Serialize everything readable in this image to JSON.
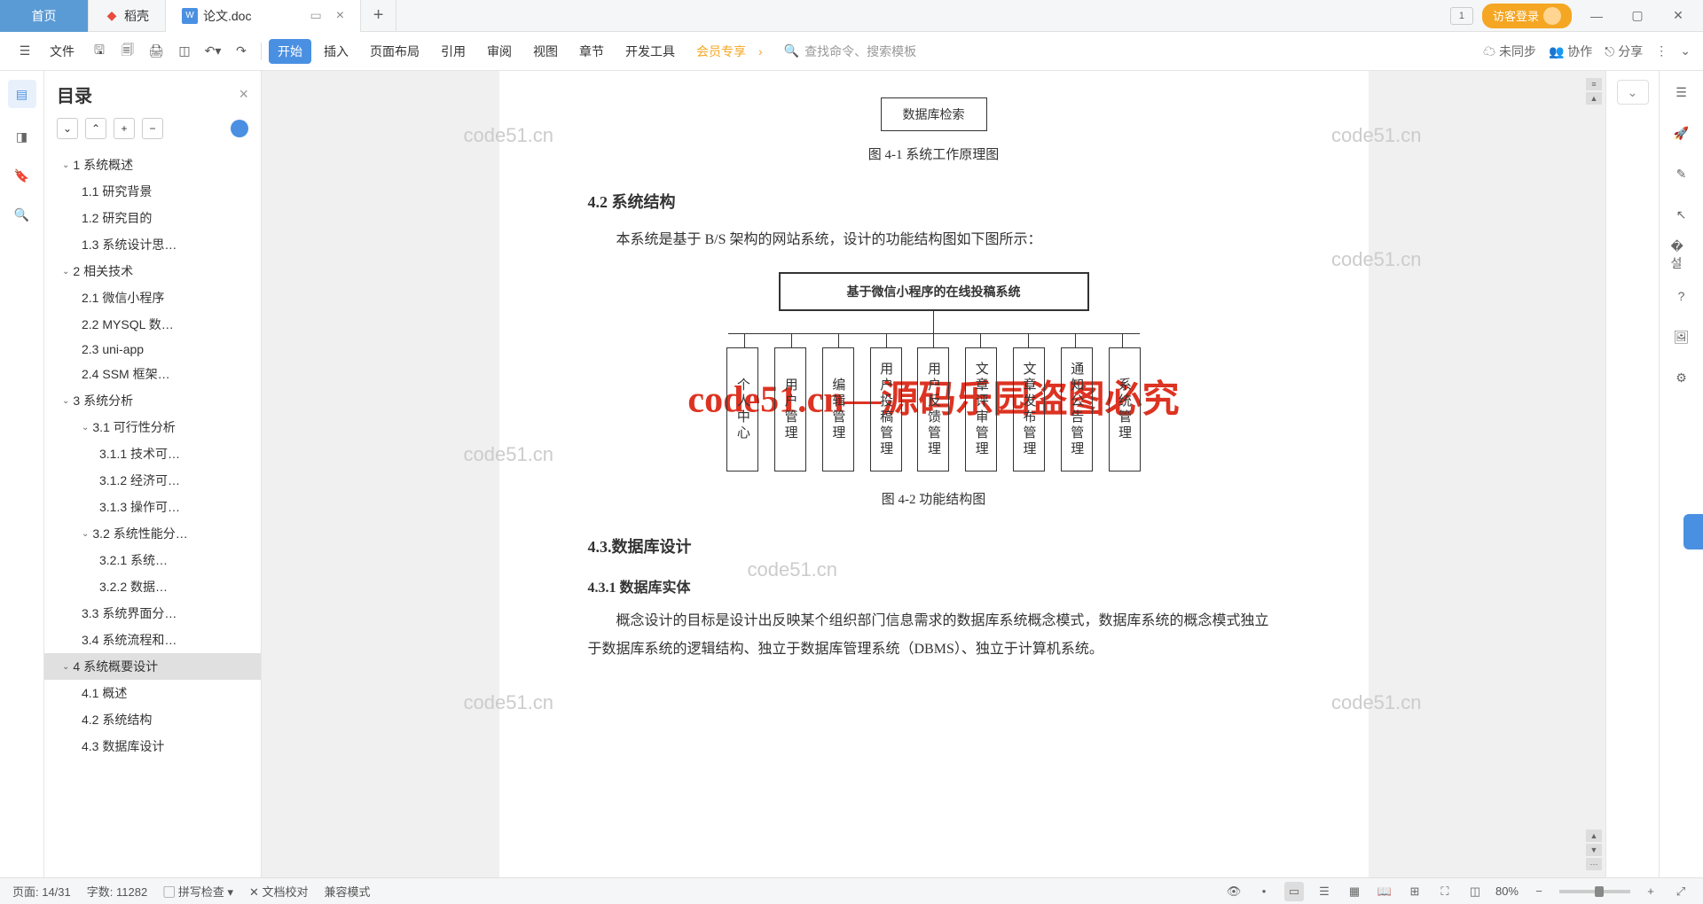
{
  "titlebar": {
    "home": "首页",
    "tab_daoke": "稻壳",
    "tab_doc": "论文.doc",
    "login": "访客登录"
  },
  "menubar": {
    "file": "文件",
    "items": [
      "开始",
      "插入",
      "页面布局",
      "引用",
      "审阅",
      "视图",
      "章节",
      "开发工具",
      "会员专享"
    ],
    "search_placeholder": "查找命令、搜索模板",
    "sync": "未同步",
    "collab": "协作",
    "share": "分享"
  },
  "toc": {
    "title": "目录",
    "items": [
      {
        "l": 1,
        "t": "1 系统概述",
        "c": true
      },
      {
        "l": 2,
        "t": "1.1 研究背景"
      },
      {
        "l": 2,
        "t": "1.2 研究目的"
      },
      {
        "l": 2,
        "t": "1.3 系统设计思…"
      },
      {
        "l": 1,
        "t": "2 相关技术",
        "c": true
      },
      {
        "l": 2,
        "t": "2.1 微信小程序"
      },
      {
        "l": 2,
        "t": "2.2 MYSQL 数…"
      },
      {
        "l": 2,
        "t": "2.3 uni-app"
      },
      {
        "l": 2,
        "t": "2.4 SSM 框架…"
      },
      {
        "l": 1,
        "t": "3 系统分析",
        "c": true
      },
      {
        "l": 2,
        "t": "3.1 可行性分析",
        "c": true
      },
      {
        "l": 3,
        "t": "3.1.1 技术可…"
      },
      {
        "l": 3,
        "t": "3.1.2 经济可…"
      },
      {
        "l": 3,
        "t": "3.1.3 操作可…"
      },
      {
        "l": 2,
        "t": "3.2 系统性能分…",
        "c": true
      },
      {
        "l": 3,
        "t": "3.2.1 系统…"
      },
      {
        "l": 3,
        "t": "3.2.2 数据…"
      },
      {
        "l": 2,
        "t": "3.3 系统界面分…"
      },
      {
        "l": 2,
        "t": "3.4 系统流程和…"
      },
      {
        "l": 1,
        "t": "4 系统概要设计",
        "c": true,
        "active": true
      },
      {
        "l": 2,
        "t": "4.1 概述"
      },
      {
        "l": 2,
        "t": "4.2 系统结构"
      },
      {
        "l": 2,
        "t": "4.3 数据库设计"
      }
    ]
  },
  "doc": {
    "db_box": "数据库检索",
    "fig41": "图 4-1 系统工作原理图",
    "h42": "4.2 系统结构",
    "p42": "本系统是基于 B/S 架构的网站系统，设计的功能结构图如下图所示：",
    "diag_title": "基于微信小程序的在线投稿系统",
    "cols": [
      "个人中心",
      "用户管理",
      "编辑管理",
      "用户投稿管理",
      "用户反馈管理",
      "文章评审管理",
      "文章发布管理",
      "通知公告管理",
      "系统管理"
    ],
    "fig42": "图 4-2 功能结构图",
    "h43": "4.3.数据库设计",
    "h431": "4.3.1 数据库实体",
    "p431": "概念设计的目标是设计出反映某个组织部门信息需求的数据库系统概念模式，数据库系统的概念模式独立于数据库系统的逻辑结构、独立于数据库管理系统（DBMS）、独立于计算机系统。",
    "watermark": "code51.cn",
    "big_watermark": "code51.cn—源码乐园盗图必究"
  },
  "statusbar": {
    "page": "页面: 14/31",
    "words": "字数: 11282",
    "spell": "拼写检查",
    "proof": "文档校对",
    "compat": "兼容模式",
    "zoom": "80%"
  }
}
